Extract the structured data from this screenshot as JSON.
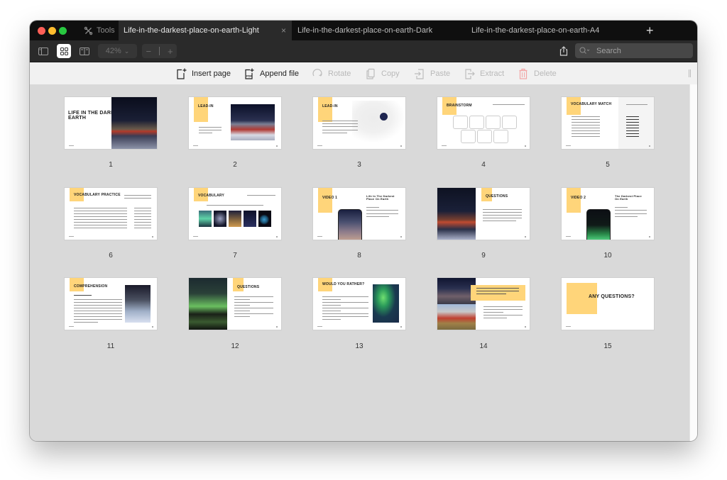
{
  "window": {
    "traffic_lights": [
      "close",
      "minimize",
      "zoom"
    ]
  },
  "tabbar": {
    "tools_label": "Tools",
    "tabs": [
      {
        "label": "Life-in-the-darkest-place-on-earth-Light",
        "active": true,
        "close": "×"
      },
      {
        "label": "Life-in-the-darkest-place-on-earth-Dark",
        "active": false
      },
      {
        "label": "Life-in-the-darkest-place-on-earth-A4",
        "active": false
      }
    ],
    "new_tab": "+"
  },
  "toolbar": {
    "zoom_level": "42%",
    "zoom_chevron": "⌄",
    "zoom_out": "−",
    "zoom_in": "+",
    "search_placeholder": "Search"
  },
  "actions": [
    {
      "label": "Insert page",
      "icon": "insert-page-icon",
      "enabled": true
    },
    {
      "label": "Append file",
      "icon": "append-pdf-icon",
      "enabled": true
    },
    {
      "label": "Rotate",
      "icon": "rotate-icon",
      "enabled": false
    },
    {
      "label": "Copy",
      "icon": "copy-icon",
      "enabled": false
    },
    {
      "label": "Paste",
      "icon": "paste-icon",
      "enabled": false
    },
    {
      "label": "Extract",
      "icon": "extract-icon",
      "enabled": false
    },
    {
      "label": "Delete",
      "icon": "trash-icon",
      "enabled": false
    }
  ],
  "pages": [
    {
      "number": "1",
      "title": "LIFE IN THE DARKEST PLACE ON EARTH"
    },
    {
      "number": "2",
      "title": "LEAD-IN"
    },
    {
      "number": "3",
      "title": "LEAD-IN"
    },
    {
      "number": "4",
      "title": "BRAINSTORM"
    },
    {
      "number": "5",
      "title": "VOCABULARY MATCH"
    },
    {
      "number": "6",
      "title": "VOCABULARY PRACTICE"
    },
    {
      "number": "7",
      "title": "VOCABULARY"
    },
    {
      "number": "8",
      "title": "VIDEO 1",
      "subtitle": "Life In The Darkest Place On Earth"
    },
    {
      "number": "9",
      "title": "QUESTIONS"
    },
    {
      "number": "10",
      "title": "VIDEO 2",
      "subtitle": "The Darkest Place On Earth"
    },
    {
      "number": "11",
      "title": "COMPREHENSION"
    },
    {
      "number": "12",
      "title": "QUESTIONS"
    },
    {
      "number": "13",
      "title": "WOULD YOU RATHER?"
    },
    {
      "number": "14",
      "title": ""
    },
    {
      "number": "15",
      "title": "ANY QUESTIONS?"
    }
  ],
  "colors": {
    "accent_yellow": "#ffd57a",
    "delete_red": "#f3a5a5"
  }
}
